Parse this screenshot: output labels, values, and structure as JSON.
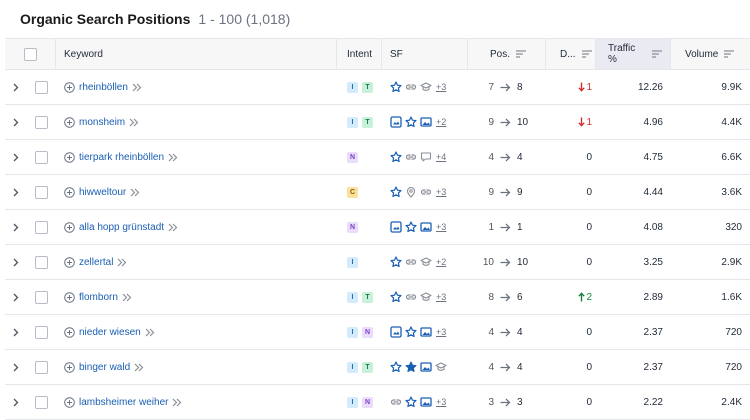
{
  "header": {
    "title": "Organic Search Positions",
    "range": "1 - 100 (1,018)"
  },
  "columns": {
    "keyword": "Keyword",
    "intent": "Intent",
    "sf": "SF",
    "pos": "Pos.",
    "diff": "D...",
    "traffic": "Traffic %",
    "volume": "Volume"
  },
  "colors": {
    "link": "#1a5fb4",
    "icon_blue": "#1a5fb4",
    "icon_gray": "#8a8f98",
    "down": "#d32f2f",
    "up": "#16803c"
  },
  "rows": [
    {
      "keyword": "rheinböllen",
      "intent": [
        "I",
        "T"
      ],
      "sf": [
        "star-icon",
        "link-icon",
        "graduation-cap-icon"
      ],
      "sf_more": "+3",
      "pos_from": "7",
      "pos_to": "8",
      "diff": "1",
      "diff_dir": "down",
      "traffic": "12.26",
      "volume": "9.9K"
    },
    {
      "keyword": "monsheim",
      "intent": [
        "I",
        "T"
      ],
      "sf": [
        "image-pack-icon",
        "star-icon",
        "image-icon"
      ],
      "sf_more": "+2",
      "pos_from": "9",
      "pos_to": "10",
      "diff": "1",
      "diff_dir": "down",
      "traffic": "4.96",
      "volume": "4.4K"
    },
    {
      "keyword": "tierpark rheinböllen",
      "intent": [
        "N"
      ],
      "sf": [
        "star-icon",
        "link-icon",
        "comment-icon"
      ],
      "sf_more": "+4",
      "pos_from": "4",
      "pos_to": "4",
      "diff": "0",
      "diff_dir": "none",
      "traffic": "4.75",
      "volume": "6.6K"
    },
    {
      "keyword": "hiwweltour",
      "intent": [
        "C"
      ],
      "sf": [
        "star-icon",
        "location-pin-icon",
        "link-icon"
      ],
      "sf_more": "+3",
      "pos_from": "9",
      "pos_to": "9",
      "diff": "0",
      "diff_dir": "none",
      "traffic": "4.44",
      "volume": "3.6K"
    },
    {
      "keyword": "alla hopp grünstadt",
      "intent": [
        "N"
      ],
      "sf": [
        "image-pack-icon",
        "star-icon",
        "image-icon"
      ],
      "sf_more": "+3",
      "pos_from": "1",
      "pos_to": "1",
      "diff": "0",
      "diff_dir": "none",
      "traffic": "4.08",
      "volume": "320"
    },
    {
      "keyword": "zellertal",
      "intent": [
        "I"
      ],
      "sf": [
        "star-icon",
        "link-icon",
        "graduation-cap-icon"
      ],
      "sf_more": "+2",
      "pos_from": "10",
      "pos_to": "10",
      "diff": "0",
      "diff_dir": "none",
      "traffic": "3.25",
      "volume": "2.9K"
    },
    {
      "keyword": "flomborn",
      "intent": [
        "I",
        "T"
      ],
      "sf": [
        "star-icon",
        "link-icon",
        "graduation-cap-icon"
      ],
      "sf_more": "+3",
      "pos_from": "8",
      "pos_to": "6",
      "diff": "2",
      "diff_dir": "up",
      "traffic": "2.89",
      "volume": "1.6K"
    },
    {
      "keyword": "nieder wiesen",
      "intent": [
        "I",
        "N"
      ],
      "sf": [
        "image-pack-icon",
        "star-icon",
        "image-icon"
      ],
      "sf_more": "+3",
      "pos_from": "4",
      "pos_to": "4",
      "diff": "0",
      "diff_dir": "none",
      "traffic": "2.37",
      "volume": "720"
    },
    {
      "keyword": "binger wald",
      "intent": [
        "I",
        "T"
      ],
      "sf": [
        "star-icon",
        "star-outline-icon",
        "image-icon",
        "graduation-cap-icon"
      ],
      "sf_more": "",
      "pos_from": "4",
      "pos_to": "4",
      "diff": "0",
      "diff_dir": "none",
      "traffic": "2.37",
      "volume": "720"
    },
    {
      "keyword": "lambsheimer weiher",
      "intent": [
        "I",
        "N"
      ],
      "sf": [
        "link-icon",
        "star-icon",
        "image-icon"
      ],
      "sf_more": "+3",
      "pos_from": "3",
      "pos_to": "3",
      "diff": "0",
      "diff_dir": "none",
      "traffic": "2.22",
      "volume": "2.4K"
    }
  ]
}
